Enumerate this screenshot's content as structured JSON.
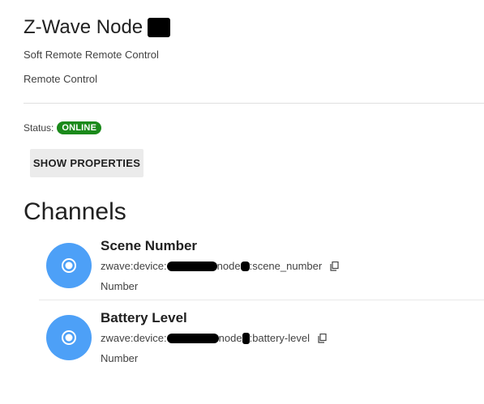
{
  "thing": {
    "title": "Z-Wave Node",
    "subtitle_1": "Soft Remote Remote Control",
    "subtitle_2": "Remote Control"
  },
  "status": {
    "label": "Status:",
    "value": "ONLINE",
    "color": "#1b8a1b"
  },
  "show_properties_label": "SHOW PROPERTIES",
  "channels": {
    "heading": "Channels",
    "items": [
      {
        "name": "Scene Number",
        "uid_prefix": "zwave:device:",
        "uid_mid": "node",
        "uid_suffix": ":scene_number",
        "type": "Number",
        "icon": "radio-button-icon",
        "copy_icon": "copy-icon"
      },
      {
        "name": "Battery Level",
        "uid_prefix": "zwave:device:",
        "uid_mid": "node",
        "uid_suffix": ":battery-level",
        "type": "Number",
        "icon": "radio-button-icon",
        "copy_icon": "copy-icon"
      }
    ]
  },
  "colors": {
    "avatar": "#4da0f7",
    "online_badge": "#1b8a1b",
    "button_bg": "#ebebeb"
  }
}
